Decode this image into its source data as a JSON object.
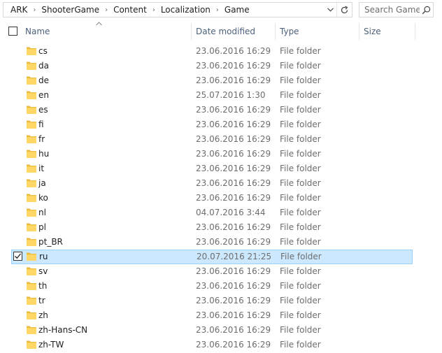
{
  "address": {
    "crumbs": [
      "ARK",
      "ShooterGame",
      "Content",
      "Localization",
      "Game"
    ]
  },
  "search": {
    "placeholder": "Search Game"
  },
  "columns": {
    "name": "Name",
    "date": "Date modified",
    "type": "Type",
    "size": "Size"
  },
  "icons": {
    "folder": "folder-icon",
    "search": "search-icon",
    "refresh": "refresh-icon",
    "dropdown": "chevron-down-icon",
    "sort": "sort-up-icon"
  },
  "colors": {
    "selection_bg": "#cce8ff",
    "selection_border": "#99d1ff",
    "folder": "#ffd767",
    "header_text": "#4c607a"
  },
  "files": [
    {
      "name": "cs",
      "date": "23.06.2016 16:29",
      "type": "File folder",
      "selected": false
    },
    {
      "name": "da",
      "date": "23.06.2016 16:29",
      "type": "File folder",
      "selected": false
    },
    {
      "name": "de",
      "date": "23.06.2016 16:29",
      "type": "File folder",
      "selected": false
    },
    {
      "name": "en",
      "date": "25.07.2016 1:30",
      "type": "File folder",
      "selected": false
    },
    {
      "name": "es",
      "date": "23.06.2016 16:29",
      "type": "File folder",
      "selected": false
    },
    {
      "name": "fi",
      "date": "23.06.2016 16:29",
      "type": "File folder",
      "selected": false
    },
    {
      "name": "fr",
      "date": "23.06.2016 16:29",
      "type": "File folder",
      "selected": false
    },
    {
      "name": "hu",
      "date": "23.06.2016 16:29",
      "type": "File folder",
      "selected": false
    },
    {
      "name": "it",
      "date": "23.06.2016 16:29",
      "type": "File folder",
      "selected": false
    },
    {
      "name": "ja",
      "date": "23.06.2016 16:29",
      "type": "File folder",
      "selected": false
    },
    {
      "name": "ko",
      "date": "23.06.2016 16:29",
      "type": "File folder",
      "selected": false
    },
    {
      "name": "nl",
      "date": "04.07.2016 3:44",
      "type": "File folder",
      "selected": false
    },
    {
      "name": "pl",
      "date": "23.06.2016 16:29",
      "type": "File folder",
      "selected": false
    },
    {
      "name": "pt_BR",
      "date": "23.06.2016 16:29",
      "type": "File folder",
      "selected": false
    },
    {
      "name": "ru",
      "date": "20.07.2016 21:25",
      "type": "File folder",
      "selected": true
    },
    {
      "name": "sv",
      "date": "23.06.2016 16:29",
      "type": "File folder",
      "selected": false
    },
    {
      "name": "th",
      "date": "23.06.2016 16:29",
      "type": "File folder",
      "selected": false
    },
    {
      "name": "tr",
      "date": "23.06.2016 16:29",
      "type": "File folder",
      "selected": false
    },
    {
      "name": "zh",
      "date": "23.06.2016 16:29",
      "type": "File folder",
      "selected": false
    },
    {
      "name": "zh-Hans-CN",
      "date": "23.06.2016 16:29",
      "type": "File folder",
      "selected": false
    },
    {
      "name": "zh-TW",
      "date": "23.06.2016 16:29",
      "type": "File folder",
      "selected": false
    }
  ]
}
